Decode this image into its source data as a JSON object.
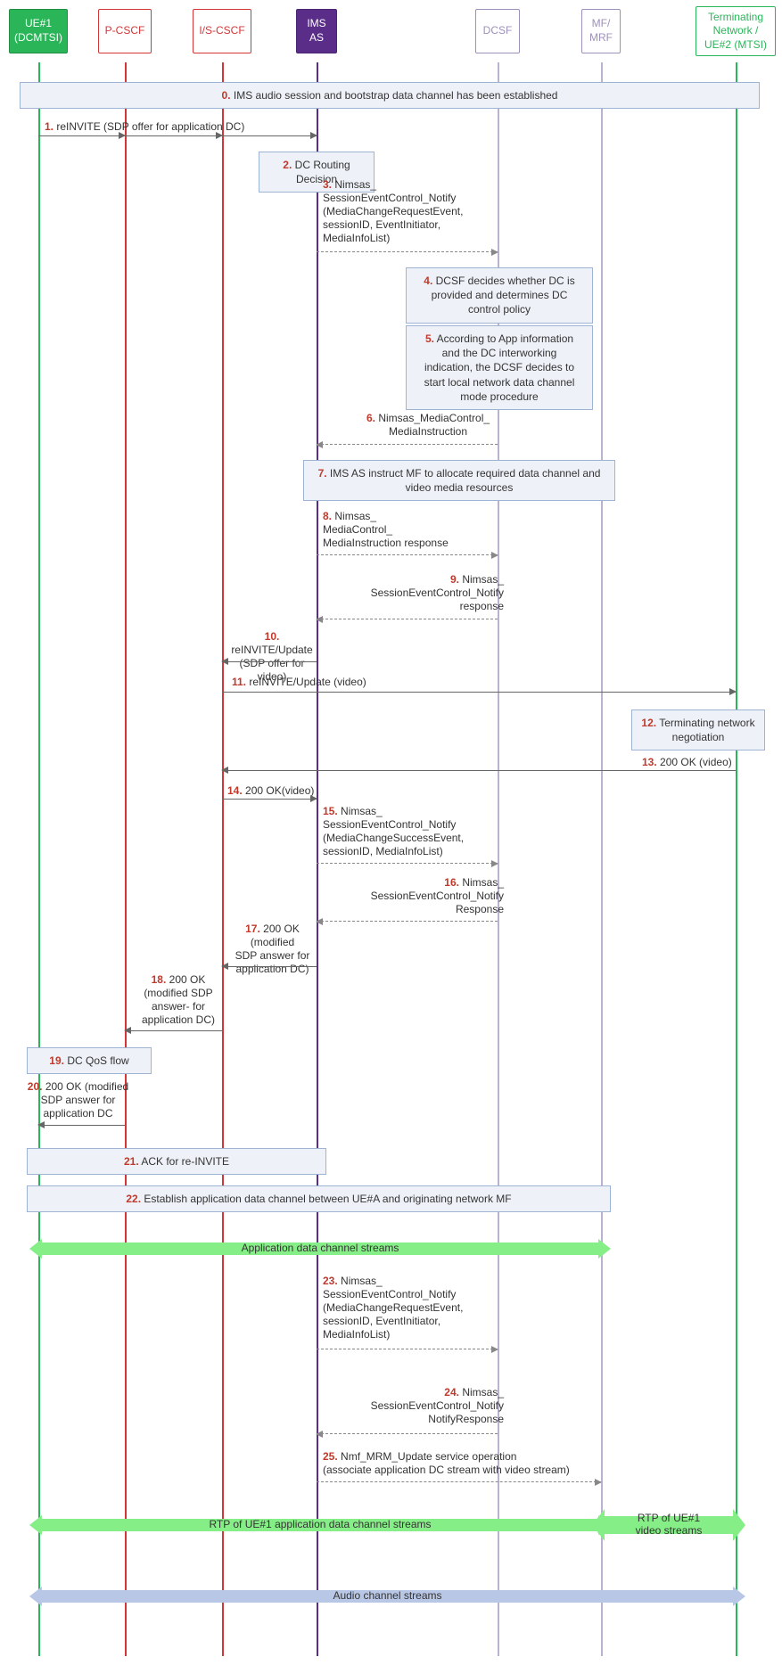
{
  "actors": {
    "ue1": "UE#1\n(DCMTSI)",
    "pcscf": "P-CSCF",
    "iscscf": "I/S-CSCF",
    "imsas": "IMS\nAS",
    "dcsf": "DCSF",
    "mfmrf": "MF/\nMRF",
    "term": "Terminating\nNetwork /\nUE#2 (MTSI)"
  },
  "steps": {
    "s0": "IMS audio session and bootstrap data channel has been established",
    "s1": "reINVITE (SDP offer for application DC)",
    "s2": "DC Routing Decision",
    "s3": "Nimsas_\nSessionEventControl_Notify\n(MediaChangeRequestEvent,\nsessionID, EventInitiator,\nMediaInfoList)",
    "s4": "DCSF decides whether DC is\nprovided and determines DC\ncontrol policy",
    "s5": "According to App information\nand the DC interworking\nindication, the DCSF decides to\nstart local network data channel\nmode procedure",
    "s6": "Nimsas_MediaControl_\nMediaInstruction",
    "s7": "IMS AS instruct MF to allocate required data channel and\nvideo media resources",
    "s8": "Nimsas_\nMediaControl_\nMediaInstruction response",
    "s9": "Nimsas_\nSessionEventControl_Notify\nresponse",
    "s10": "reINVITE/Update\n(SDP offer for video)",
    "s11": "reINVITE/Update (video)",
    "s12": "Terminating network\nnegotiation",
    "s13": "200 OK (video)",
    "s14": "200 OK(video)",
    "s15": "Nimsas_\nSessionEventControl_Notify\n(MediaChangeSuccessEvent,\nsessionID, MediaInfoList)",
    "s16": "Nimsas_\nSessionEventControl_Notify\nResponse",
    "s17": "200 OK (modified\nSDP answer for\napplication DC)",
    "s18": "200 OK\n(modified SDP\nanswer- for\napplication DC)",
    "s19": "DC QoS flow",
    "s20": "200 OK (modified\nSDP answer for\napplication DC",
    "s21": "ACK for re-INVITE",
    "s22": "Establish application data channel between UE#A and originating network MF",
    "s23": "Nimsas_\nSessionEventControl_Notify\n(MediaChangeRequestEvent,\nsessionID, EventInitiator,\nMediaInfoList)",
    "s24": "Nimsas_\nSessionEventControl_Notify\nNotifyResponse",
    "s25": "Nmf_MRM_Update service operation\n(associate application DC stream with video stream)"
  },
  "streams": {
    "app": "Application data channel streams",
    "rtp_dc": "RTP of UE#1 application data channel streams",
    "rtp_vid": "RTP of UE#1\nvideo streams",
    "audio": "Audio channel streams"
  },
  "nums": {
    "n0": "0.",
    "n1": "1.",
    "n2": "2.",
    "n3": "3.",
    "n4": "4.",
    "n5": "5.",
    "n6": "6.",
    "n7": "7.",
    "n8": "8.",
    "n9": "9.",
    "n10": "10.",
    "n11": "11.",
    "n12": "12.",
    "n13": "13.",
    "n14": "14.",
    "n15": "15.",
    "n16": "16.",
    "n17": "17.",
    "n18": "18.",
    "n19": "19.",
    "n20": "20.",
    "n21": "21.",
    "n22": "22.",
    "n23": "23.",
    "n24": "24.",
    "n25": "25."
  },
  "lifeline_x": {
    "ue1": 43,
    "pcscf": 140,
    "iscscf": 249,
    "imsas": 355,
    "dcsf": 558,
    "mfmrf": 674,
    "term": 825
  }
}
